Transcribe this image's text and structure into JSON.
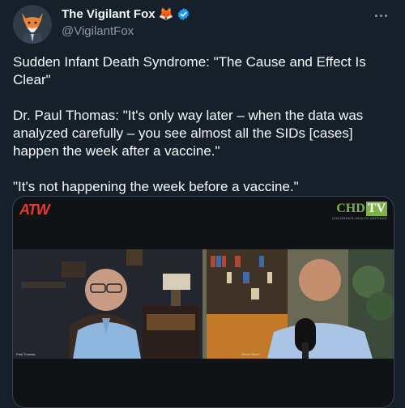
{
  "author": {
    "display_name": "The Vigilant Fox",
    "emoji": "🦊",
    "handle": "@VigilantFox",
    "avatar": "fox-avatar-icon"
  },
  "tweet": {
    "paragraphs": [
      "Sudden Infant Death Syndrome: \"The Cause and Effect Is Clear\"",
      "Dr. Paul Thomas: \"It's only way later – when the data was analyzed carefully – you see almost all the SIDs [cases] happen the week after a vaccine.\"",
      "\"It's not happening the week before a vaccine.\""
    ]
  },
  "media": {
    "left_logo": "ATW",
    "right_logo_main": "CHD",
    "right_logo_tv": "TV",
    "right_logo_sub": "CHILDREN'S HEALTH DEFENSE",
    "left_caption": "Paul Thomas",
    "right_caption": "Steve Kirsch"
  },
  "colors": {
    "background": "#15202b",
    "verified_blue": "#1d9bf0",
    "secondary_text": "#8b98a5"
  }
}
